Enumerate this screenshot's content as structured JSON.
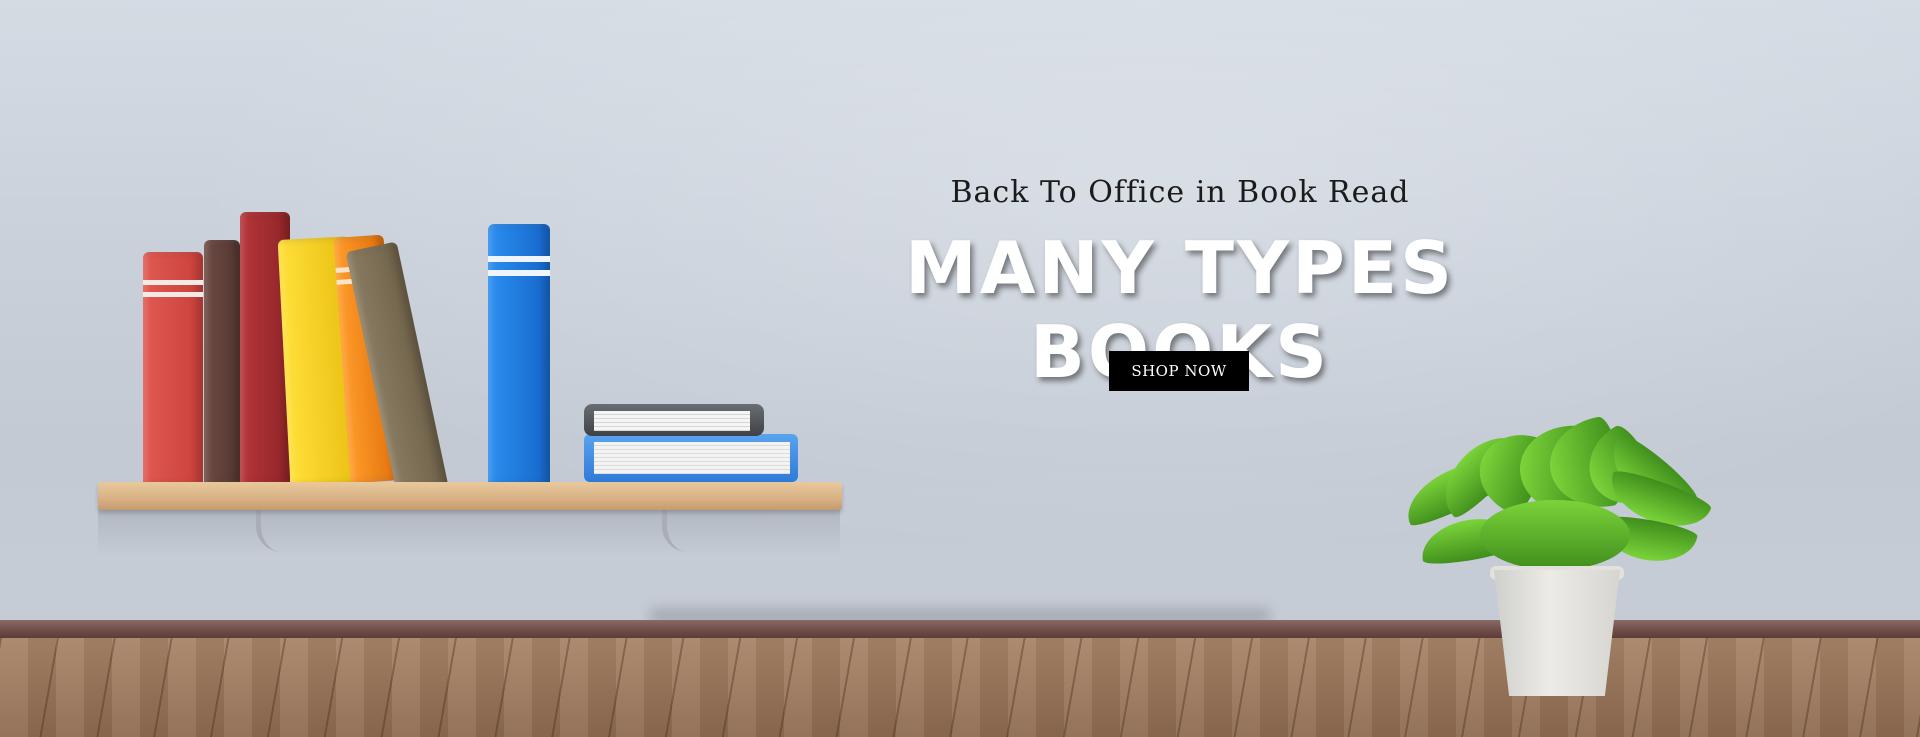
{
  "hero": {
    "subtitle": "Back To Office in Book Read",
    "title": "MANY TYPES BOOKS",
    "cta_label": "SHOP NOW"
  },
  "colors": {
    "button_bg": "#000000",
    "button_text": "#ffffff",
    "title_text": "#ffffff",
    "subtitle_text": "#1b1b1b"
  },
  "scene": {
    "illustrations": [
      "bookshelf-with-books",
      "potted-fern-plant",
      "wooden-floor"
    ]
  }
}
